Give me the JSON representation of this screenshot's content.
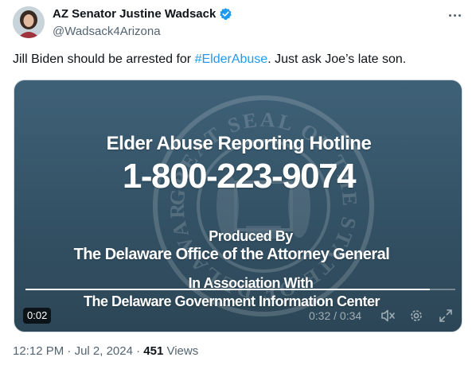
{
  "author": {
    "display_name": "AZ Senator Justine Wadsack",
    "handle": "@Wadsack4Arizona",
    "verified_badge": "verified-check-icon"
  },
  "tweet": {
    "text_before": "Jill Biden should be arrested for ",
    "hashtag": "#ElderAbuse",
    "text_after": ". Just ask Joe’s late son."
  },
  "video": {
    "title": "Elder Abuse Reporting Hotline",
    "phone": "1-800-223-9074",
    "produced_by": "Produced By",
    "office": "The Delaware Office of the Attorney General",
    "association": "In Association With",
    "info_center": "The Delaware Government Information Center",
    "seal_text": "GREAT SEAL OF THE STATE OF DELAWARE",
    "remaining_badge": "0:02",
    "time_readout": "0:32 / 0:34",
    "progress": 0.94
  },
  "meta": {
    "time": "12:12 PM",
    "separator": " · ",
    "date": "Jul 2, 2024",
    "views_count": "451",
    "views_label": " Views"
  },
  "colors": {
    "link": "#1d9bf0",
    "secondary_text": "#536471",
    "primary_text": "#0f1419",
    "video_bg": "#355468"
  }
}
